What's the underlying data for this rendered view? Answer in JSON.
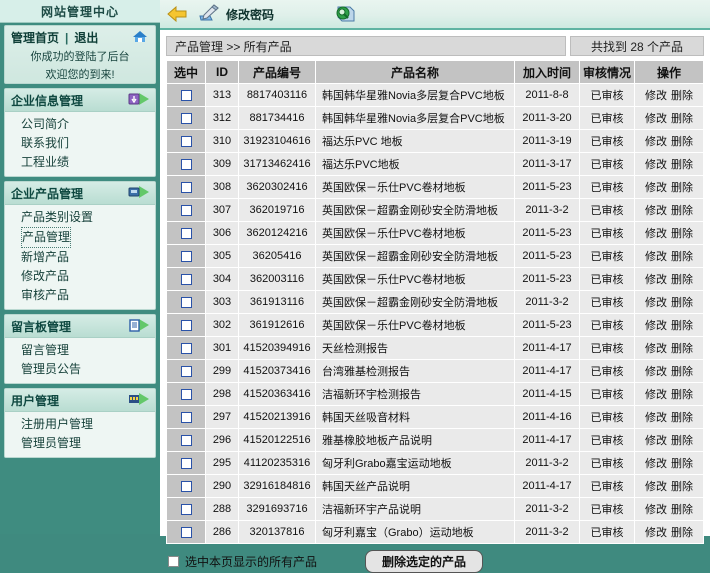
{
  "sidebar": {
    "brand": "网站管理中心",
    "welcome": {
      "home_label": "管理首页",
      "separator": "|",
      "logout_label": "退出",
      "line1": "你成功的登陆了后台",
      "line2": "欢迎您的到来!"
    },
    "groups": [
      {
        "title": "企业信息管理",
        "icon": "download-arrow-icon",
        "items": [
          "公司简介",
          "联系我们",
          "工程业绩"
        ]
      },
      {
        "title": "企业产品管理",
        "icon": "box-arrow-icon",
        "items": [
          "产品类别设置",
          "产品管理",
          "新增产品",
          "修改产品",
          "审核产品"
        ],
        "active": "产品管理"
      },
      {
        "title": "留言板管理",
        "icon": "note-arrow-icon",
        "items": [
          "留言管理",
          "管理员公告"
        ]
      },
      {
        "title": "用户管理",
        "icon": "users-arrow-icon",
        "items": [
          "注册用户管理",
          "管理员管理"
        ]
      }
    ]
  },
  "toolbar": {
    "back_icon": "back-arrow-icon",
    "password_icon": "pencil-book-icon",
    "password_label": "修改密码",
    "search_icon": "search-book-icon"
  },
  "main": {
    "breadcrumb": "产品管理 >> 所有产品",
    "count_text": "共找到 28 个产品",
    "columns": [
      "选中",
      "ID",
      "产品编号",
      "产品名称",
      "加入时间",
      "审核情况",
      "操作"
    ],
    "rows": [
      {
        "id": "313",
        "no": "8817403116",
        "name": "韩国韩华星雅Novia多层复合PVC地板",
        "date": "2011-8-8",
        "status": "已审核",
        "edit": "修改",
        "del": "删除"
      },
      {
        "id": "312",
        "no": "881734416",
        "name": "韩国韩华星雅Novia多层复合PVC地板",
        "date": "2011-3-20",
        "status": "已审核",
        "edit": "修改",
        "del": "删除"
      },
      {
        "id": "310",
        "no": "31923104616",
        "name": "福达乐PVC 地板",
        "date": "2011-3-19",
        "status": "已审核",
        "edit": "修改",
        "del": "删除"
      },
      {
        "id": "309",
        "no": "31713462416",
        "name": "福达乐PVC地板",
        "date": "2011-3-17",
        "status": "已审核",
        "edit": "修改",
        "del": "删除"
      },
      {
        "id": "308",
        "no": "3620302416",
        "name": "英国欧保－乐仕PVC卷材地板",
        "date": "2011-5-23",
        "status": "已审核",
        "edit": "修改",
        "del": "删除"
      },
      {
        "id": "307",
        "no": "362019716",
        "name": "英国欧保－超霸金刚砂安全防滑地板",
        "date": "2011-3-2",
        "status": "已审核",
        "edit": "修改",
        "del": "删除"
      },
      {
        "id": "306",
        "no": "3620124216",
        "name": "英国欧保－乐仕PVC卷材地板",
        "date": "2011-5-23",
        "status": "已审核",
        "edit": "修改",
        "del": "删除"
      },
      {
        "id": "305",
        "no": "36205416",
        "name": "英国欧保－超霸金刚砂安全防滑地板",
        "date": "2011-5-23",
        "status": "已审核",
        "edit": "修改",
        "del": "删除"
      },
      {
        "id": "304",
        "no": "362003116",
        "name": "英国欧保－乐仕PVC卷材地板",
        "date": "2011-5-23",
        "status": "已审核",
        "edit": "修改",
        "del": "删除"
      },
      {
        "id": "303",
        "no": "361913116",
        "name": "英国欧保－超霸金刚砂安全防滑地板",
        "date": "2011-3-2",
        "status": "已审核",
        "edit": "修改",
        "del": "删除"
      },
      {
        "id": "302",
        "no": "361912616",
        "name": "英国欧保－乐仕PVC卷材地板",
        "date": "2011-5-23",
        "status": "已审核",
        "edit": "修改",
        "del": "删除"
      },
      {
        "id": "301",
        "no": "41520394916",
        "name": "天丝检测报告",
        "date": "2011-4-17",
        "status": "已审核",
        "edit": "修改",
        "del": "删除"
      },
      {
        "id": "299",
        "no": "41520373416",
        "name": "台湾雅基检测报告",
        "date": "2011-4-17",
        "status": "已审核",
        "edit": "修改",
        "del": "删除"
      },
      {
        "id": "298",
        "no": "41520363416",
        "name": "洁福新环宇检测报告",
        "date": "2011-4-15",
        "status": "已审核",
        "edit": "修改",
        "del": "删除"
      },
      {
        "id": "297",
        "no": "41520213916",
        "name": "韩国天丝吸音材料",
        "date": "2011-4-16",
        "status": "已审核",
        "edit": "修改",
        "del": "删除"
      },
      {
        "id": "296",
        "no": "41520122516",
        "name": "雅基橡胶地板产品说明",
        "date": "2011-4-17",
        "status": "已审核",
        "edit": "修改",
        "del": "删除"
      },
      {
        "id": "295",
        "no": "41120235316",
        "name": "匈牙利Grabo嘉宝运动地板",
        "date": "2011-3-2",
        "status": "已审核",
        "edit": "修改",
        "del": "删除"
      },
      {
        "id": "290",
        "no": "32916184816",
        "name": "韩国天丝产品说明",
        "date": "2011-4-17",
        "status": "已审核",
        "edit": "修改",
        "del": "删除"
      },
      {
        "id": "288",
        "no": "3291693716",
        "name": "洁福新环宇产品说明",
        "date": "2011-3-2",
        "status": "已审核",
        "edit": "修改",
        "del": "删除"
      },
      {
        "id": "286",
        "no": "320137816",
        "name": "匈牙利嘉宝（Grabo）运动地板",
        "date": "2011-3-2",
        "status": "已审核",
        "edit": "修改",
        "del": "删除"
      }
    ],
    "footer": {
      "select_all_label": "选中本页显示的所有产品",
      "delete_button": "删除选定的产品"
    }
  },
  "colors": {
    "teal": "#3f8c80",
    "panel": "#e7f3ef",
    "header_gray": "#c3c3c3",
    "row_gray": "#eaeaea",
    "accent_border": "#5fb3a2"
  }
}
